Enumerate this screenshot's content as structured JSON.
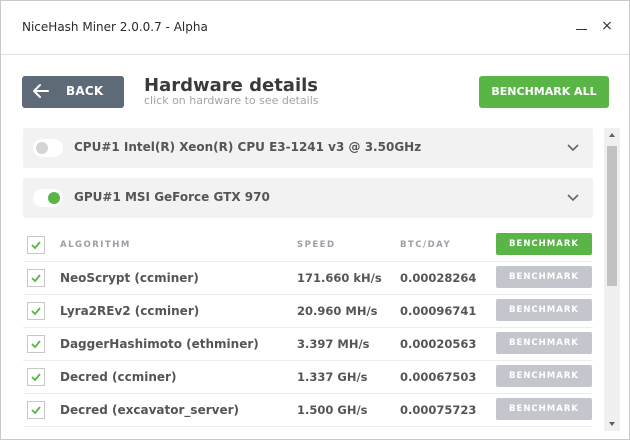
{
  "window": {
    "title": "NiceHash Miner 2.0.0.7 - Alpha",
    "minimize": "minimize",
    "close": "×"
  },
  "header": {
    "back_label": "BACK",
    "title": "Hardware details",
    "subtitle": "click on hardware to see details",
    "benchmark_all_label": "BENCHMARK ALL"
  },
  "devices": [
    {
      "name": "CPU#1 Intel(R) Xeon(R) CPU E3-1241 v3 @ 3.50GHz",
      "enabled": false
    },
    {
      "name": "GPU#1 MSI GeForce GTX 970",
      "enabled": true
    }
  ],
  "table": {
    "headers": {
      "algorithm": "ALGORITHM",
      "speed": "SPEED",
      "btc_day": "BTC/DAY",
      "benchmark": "BENCHMARK"
    },
    "rows": [
      {
        "algorithm": "NeoScrypt (ccminer)",
        "speed": "171.660 kH/s",
        "btc": "0.00028264",
        "button": "BENCHMARK"
      },
      {
        "algorithm": "Lyra2REv2 (ccminer)",
        "speed": "20.960 MH/s",
        "btc": "0.00096741",
        "button": "BENCHMARK"
      },
      {
        "algorithm": "DaggerHashimoto (ethminer)",
        "speed": "3.397 MH/s",
        "btc": "0.00020563",
        "button": "BENCHMARK"
      },
      {
        "algorithm": "Decred (ccminer)",
        "speed": "1.337 GH/s",
        "btc": "0.00067503",
        "button": "BENCHMARK"
      },
      {
        "algorithm": "Decred (excavator_server)",
        "speed": "1.500 GH/s",
        "btc": "0.00075723",
        "button": "BENCHMARK"
      }
    ]
  },
  "colors": {
    "accent_green": "#59b646",
    "back_button": "#5f6a79",
    "disabled_button": "#c3c7cd"
  }
}
